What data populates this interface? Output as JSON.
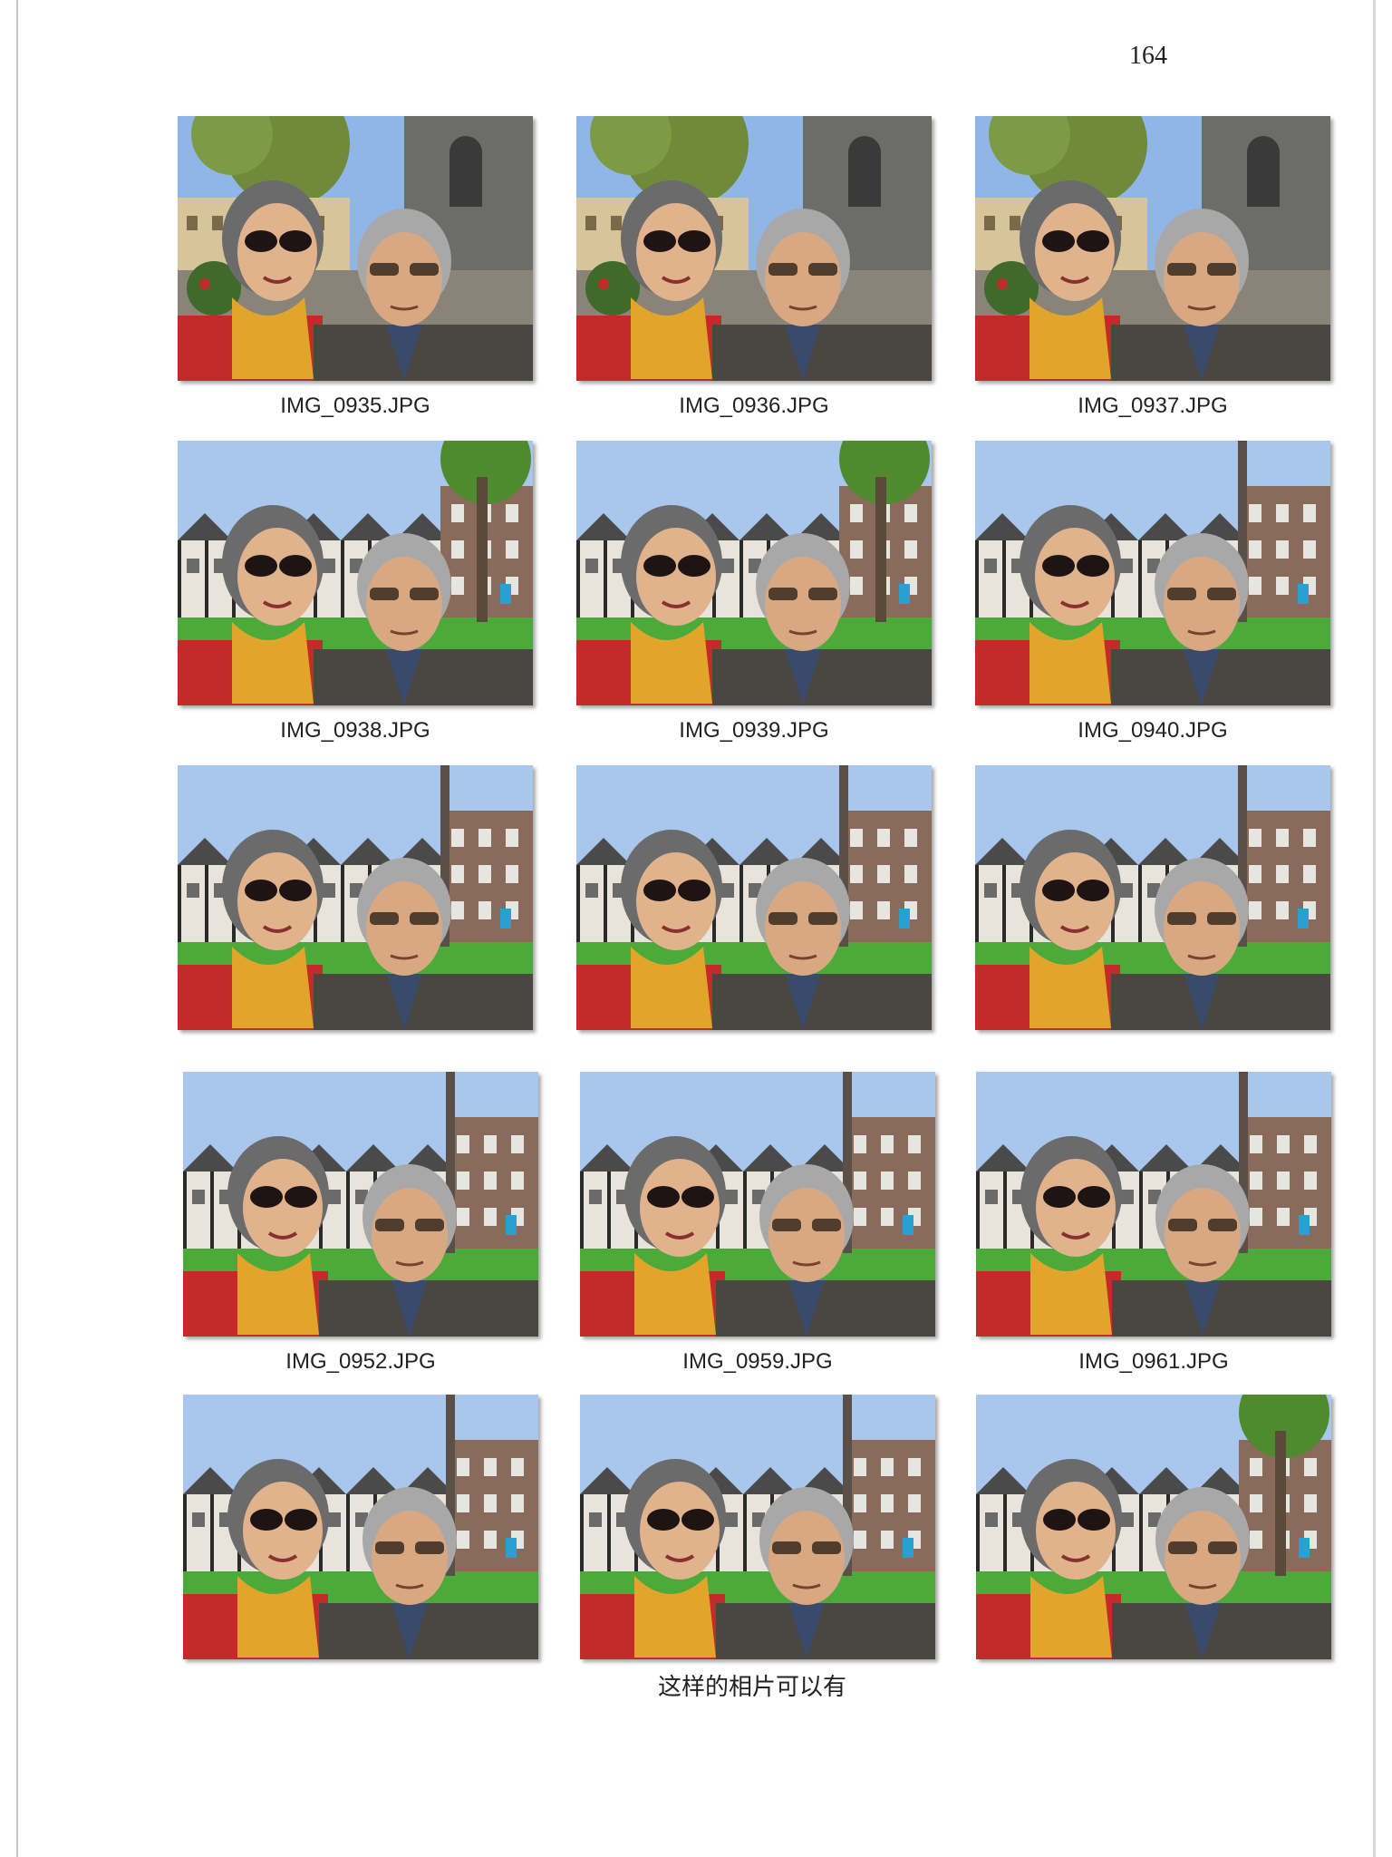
{
  "page_number": "164",
  "caption": "这样的相片可以有",
  "photos": [
    {
      "label": "IMG_0935.JPG",
      "scene": "tower"
    },
    {
      "label": "IMG_0936.JPG",
      "scene": "tower"
    },
    {
      "label": "IMG_0937.JPG",
      "scene": "tower"
    },
    {
      "label": "IMG_0938.JPG",
      "scene": "tudor-tree"
    },
    {
      "label": "IMG_0939.JPG",
      "scene": "tudor-tree"
    },
    {
      "label": "IMG_0940.JPG",
      "scene": "tudor"
    },
    {
      "label": "",
      "scene": "tudor"
    },
    {
      "label": "",
      "scene": "tudor"
    },
    {
      "label": "",
      "scene": "tudor"
    },
    {
      "label": "IMG_0952.JPG",
      "scene": "tudor"
    },
    {
      "label": "IMG_0959.JPG",
      "scene": "tudor"
    },
    {
      "label": "IMG_0961.JPG",
      "scene": "tudor"
    },
    {
      "label": "",
      "scene": "tudor"
    },
    {
      "label": "",
      "scene": "tudor"
    },
    {
      "label": "",
      "scene": "tudor-tree"
    }
  ]
}
